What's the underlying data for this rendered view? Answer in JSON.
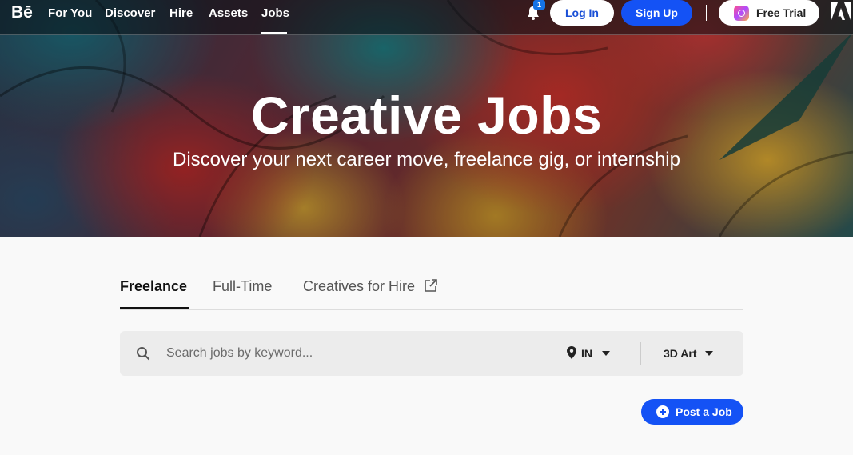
{
  "nav": {
    "logo": "Bē",
    "links": [
      "For You",
      "Discover",
      "Hire",
      "Assets",
      "Jobs"
    ],
    "active_link": "Jobs",
    "notification_count": "1",
    "login_label": "Log In",
    "signup_label": "Sign Up",
    "trial_label": "Free Trial",
    "icons": [
      "bell-icon",
      "creative-cloud-icon",
      "adobe-logo-icon"
    ]
  },
  "hero": {
    "title": "Creative Jobs",
    "subtitle": "Discover your next career move, freelance gig, or internship"
  },
  "tabs": {
    "items": [
      "Freelance",
      "Full-Time",
      "Creatives for Hire"
    ],
    "active": "Freelance"
  },
  "search": {
    "placeholder": "Search jobs by keyword...",
    "value": "",
    "location": "IN",
    "category": "3D Art"
  },
  "actions": {
    "post_job_label": "Post a Job"
  },
  "colors": {
    "primary_blue": "#1452f5",
    "login_text": "#1a4fd6",
    "badge_blue": "#1473e6"
  }
}
